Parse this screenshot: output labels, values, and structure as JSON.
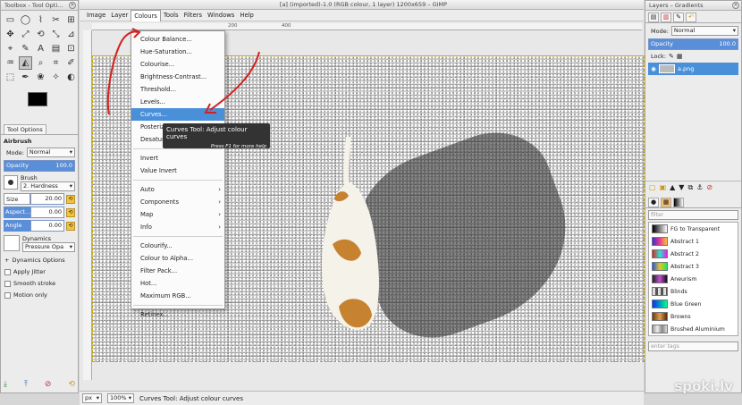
{
  "toolbox": {
    "title": "Toolbox - Tool Opti...",
    "tools": [
      "▭",
      "◯",
      "⌇",
      "✂",
      "⊞",
      "✥",
      "⤢",
      "⟲",
      "⤡",
      "⊿",
      "⌖",
      "✎",
      "A",
      "▤",
      "⊡",
      "♒",
      "◭",
      "⌕",
      "⌗",
      "✐",
      "⬚",
      "✒",
      "❀",
      "✧",
      "◐"
    ],
    "tab_label": "Tool Options",
    "options_title": "Airbrush",
    "mode_label": "Mode:",
    "mode_value": "Normal",
    "opacity_label": "Opacity",
    "opacity_value": "100.0",
    "brush_label": "Brush",
    "brush_value": "2. Hardness",
    "size_label": "Size",
    "size_value": "20.00",
    "aspect_label": "Aspect...",
    "aspect_value": "0.00",
    "angle_label": "Angle",
    "angle_value": "0.00",
    "dynamics_label": "Dynamics",
    "dynamics_value": "Pressure Opa",
    "dynamics_options": "Dynamics Options",
    "checks": [
      "Apply Jitter",
      "Smooth stroke",
      "Motion only"
    ]
  },
  "window": {
    "title": "[a] (imported)-1.0 (RGB colour, 1 layer) 1200x659 – GIMP",
    "menus": [
      "Image",
      "Layer",
      "Colours",
      "Tools",
      "Filters",
      "Windows",
      "Help"
    ],
    "ruler_labels": [
      "200",
      "400"
    ]
  },
  "colours_menu": {
    "items": [
      {
        "label": "Colour Balance...",
        "type": "item"
      },
      {
        "label": "Hue-Saturation...",
        "type": "item"
      },
      {
        "label": "Colourise...",
        "type": "item"
      },
      {
        "label": "Brightness-Contrast...",
        "type": "item"
      },
      {
        "label": "Threshold...",
        "type": "item"
      },
      {
        "label": "Levels...",
        "type": "item"
      },
      {
        "label": "Curves...",
        "type": "selected"
      },
      {
        "label": "Posterize...",
        "type": "item"
      },
      {
        "label": "Desaturate...",
        "type": "item"
      },
      {
        "label": "",
        "type": "sep"
      },
      {
        "label": "Invert",
        "type": "item"
      },
      {
        "label": "Value Invert",
        "type": "item"
      },
      {
        "label": "",
        "type": "sep"
      },
      {
        "label": "Auto",
        "type": "sub"
      },
      {
        "label": "Components",
        "type": "sub"
      },
      {
        "label": "Map",
        "type": "sub"
      },
      {
        "label": "Info",
        "type": "sub"
      },
      {
        "label": "",
        "type": "sep"
      },
      {
        "label": "Colourify...",
        "type": "item"
      },
      {
        "label": "Colour to Alpha...",
        "type": "item"
      },
      {
        "label": "Filter Pack...",
        "type": "item"
      },
      {
        "label": "Hot...",
        "type": "item"
      },
      {
        "label": "Maximum RGB...",
        "type": "item"
      },
      {
        "label": "",
        "type": "sep"
      },
      {
        "label": "Retinex...",
        "type": "item"
      }
    ]
  },
  "tooltip": {
    "title": "Curves Tool: Adjust colour curves",
    "hint": "Press F1 for more help"
  },
  "statusbar": {
    "unit": "px",
    "zoom": "100%",
    "message": "Curves Tool: Adjust colour curves"
  },
  "dock": {
    "title": "Layers – Gradients",
    "mode_label": "Mode:",
    "mode_value": "Normal",
    "opacity_label": "Opacity",
    "opacity_value": "100.0",
    "lock_label": "Lock:",
    "layer_name": "a.png",
    "gradients": [
      {
        "name": "FG to Transparent",
        "colors": "linear-gradient(90deg,#000,transparent)"
      },
      {
        "name": "Abstract 1",
        "colors": "linear-gradient(90deg,#3a2dd6,#e83a8f,#f9c33c)"
      },
      {
        "name": "Abstract 2",
        "colors": "linear-gradient(90deg,#e81e1e,#1ee8d8,#e81ed8)"
      },
      {
        "name": "Abstract 3",
        "colors": "linear-gradient(90deg,#1e5ae8,#e8c81e,#1ee85a)"
      },
      {
        "name": "Aneurism",
        "colors": "linear-gradient(90deg,#222,#c34fd6,#111)"
      },
      {
        "name": "Blinds",
        "colors": "repeating-linear-gradient(90deg,#ddd 0 3px,#555 3px 6px)"
      },
      {
        "name": "Blue Green",
        "colors": "linear-gradient(90deg,#0033ff,#00ff88)"
      },
      {
        "name": "Browns",
        "colors": "linear-gradient(90deg,#6b3a12,#e0a050,#5b2a0a)"
      },
      {
        "name": "Brushed Aluminium",
        "colors": "linear-gradient(90deg,#999,#eee,#888,#ddd)"
      }
    ],
    "filter_placeholder": "enter tags"
  },
  "watermark": "spoki.lv"
}
